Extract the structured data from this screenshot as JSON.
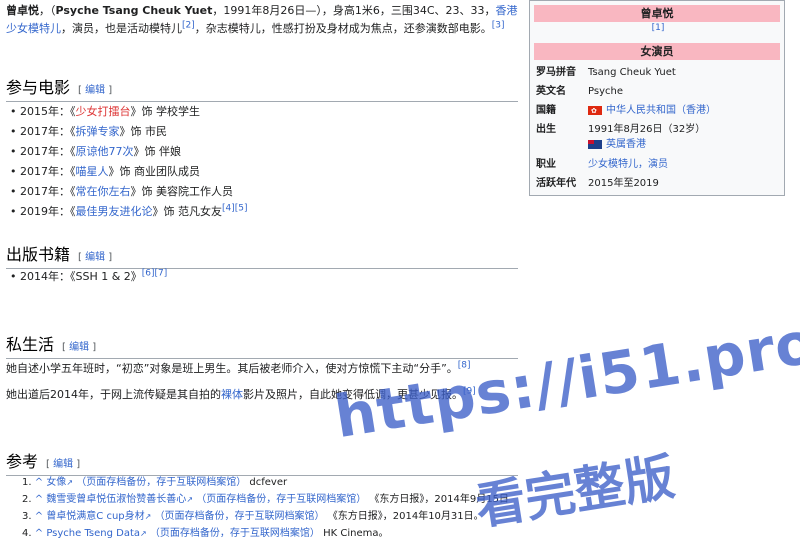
{
  "intro": {
    "name": "曾卓悦",
    "open_paren": "，（",
    "english_name": "Psyche Tsang Cheuk Yuet",
    "rest1": "，1991年8月26日—），身高1米6，三围34C、23、33，",
    "link_model": "香港少女模特儿",
    "rest2": "，演员，也是活动模特儿",
    "ref2": "[2]",
    "rest3": "，杂志模特儿，性感打扮及身材成为焦点，还参演数部电影。",
    "ref3": "[3]"
  },
  "sections": {
    "films_title": "参与电影",
    "books_title": "出版书籍",
    "private_title": "私生活",
    "refs_title": "参考",
    "edit_label": "编辑"
  },
  "films": [
    {
      "pre": "2015年：《",
      "title": "少女打擂台",
      "post": "》饰 学校学生",
      "sup": "",
      "red": true
    },
    {
      "pre": "2017年：《",
      "title": "拆弹专家",
      "post": "》饰 市民",
      "sup": "",
      "red": false
    },
    {
      "pre": "2017年：《",
      "title": "原谅他77次",
      "post": "》饰 伴娘",
      "sup": "",
      "red": false
    },
    {
      "pre": "2017年：《",
      "title": "喵星人",
      "post": "》饰 商业团队成员",
      "sup": "",
      "red": false
    },
    {
      "pre": "2017年：《",
      "title": "常在你左右",
      "post": "》饰 美容院工作人员",
      "sup": "",
      "red": false
    },
    {
      "pre": "2019年：《",
      "title": "最佳男友进化论",
      "post": "》饰 范凡女友",
      "sup": "[4][5]",
      "red": false
    }
  ],
  "books": [
    {
      "text": "2014年：《SSH 1 & 2》",
      "sup": "[6][7]"
    }
  ],
  "private": {
    "p1": "她自述小学五年班时，“初恋”对象是班上男生。其后被老师介入，使对方惊慌下主动“分手”。",
    "p1_ref": "[8]",
    "p2_pre": "她出道后2014年，于网上流传疑是其自拍的",
    "p2_link": "裸体",
    "p2_post": "影片及照片，自此她变得低调，更甚少见报。",
    "p2_ref": "[9]"
  },
  "refs": [
    {
      "num": "1.",
      "caret": "^",
      "title": "女像",
      "archive": "（页面存档备份，存于互联网档案馆）",
      "tail": "dcfever"
    },
    {
      "num": "2.",
      "caret": "^",
      "title": "魏雪雯曾卓悦伍淑怡赞善长善心",
      "archive": "（页面存档备份，存于互联网档案馆）",
      "tail": "《东方日报》，2014年9月15日"
    },
    {
      "num": "3.",
      "caret": "^",
      "title": "曾卓悦满意C cup身材",
      "archive": "（页面存档备份，存于互联网档案馆）",
      "tail": "《东方日报》，2014年10月31日。"
    },
    {
      "num": "4.",
      "caret": "^",
      "title": "Psyche Tseng Data",
      "archive": "（页面存档备份，存于互联网档案馆）",
      "tail": "HK Cinema。"
    }
  ],
  "infobox": {
    "title": "曾卓悦",
    "note": "[1]",
    "role": "女演员",
    "rows": [
      {
        "k": "罗马拼音",
        "v": "Tsang Cheuk Yuet"
      },
      {
        "k": "英文名",
        "v": "Psyche"
      },
      {
        "k": "国籍",
        "v": "中华人民共和国（香港）"
      },
      {
        "k": "出生",
        "v": "1991年8月26日（32岁）"
      },
      {
        "k": "",
        "v": "英属香港"
      },
      {
        "k": "职业",
        "v": "少女模特儿，演员"
      },
      {
        "k": "活跃年代",
        "v": "2015年至2019"
      }
    ]
  },
  "watermark": {
    "line1": "https://i51.pro",
    "line2": "看完整版"
  },
  "icons": {
    "external": "external-link-icon",
    "flag_hk": "hong-kong-flag-icon",
    "flag_uk": "british-hong-kong-flag-icon"
  }
}
